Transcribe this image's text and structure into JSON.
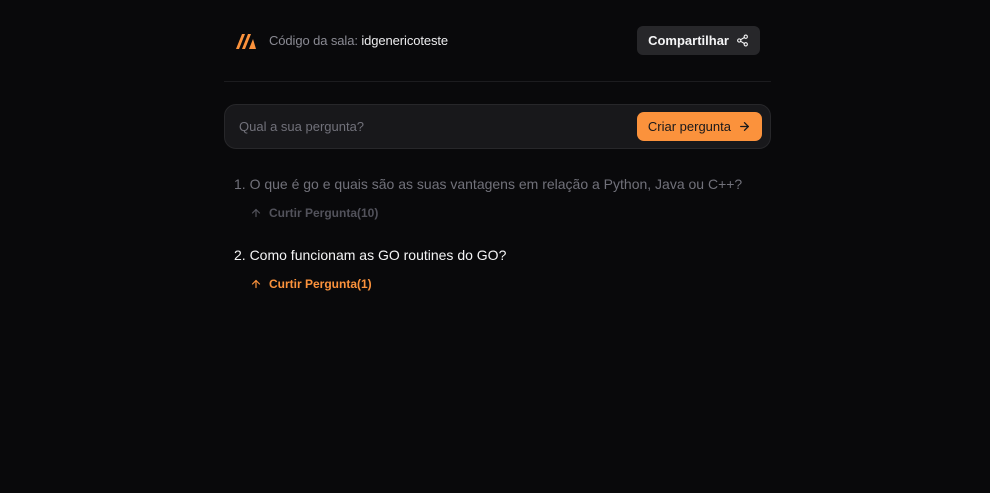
{
  "header": {
    "room_label": "Código da sala:",
    "room_id": "idgenericoteste",
    "share_label": "Compartilhar"
  },
  "ask": {
    "placeholder": "Qual a sua pergunta?",
    "button_label": "Criar pergunta"
  },
  "questions": [
    {
      "text": "1. O que é go e quais são as suas vantagens em relação a Python, Java ou C++?",
      "like_label": "Curtir Pergunta(10)",
      "liked": false
    },
    {
      "text": "2. Como funcionam as GO routines do GO?",
      "like_label": "Curtir Pergunta(1)",
      "liked": true
    }
  ],
  "colors": {
    "accent": "#fb923c",
    "background": "#09090b",
    "muted": "#71717a"
  }
}
